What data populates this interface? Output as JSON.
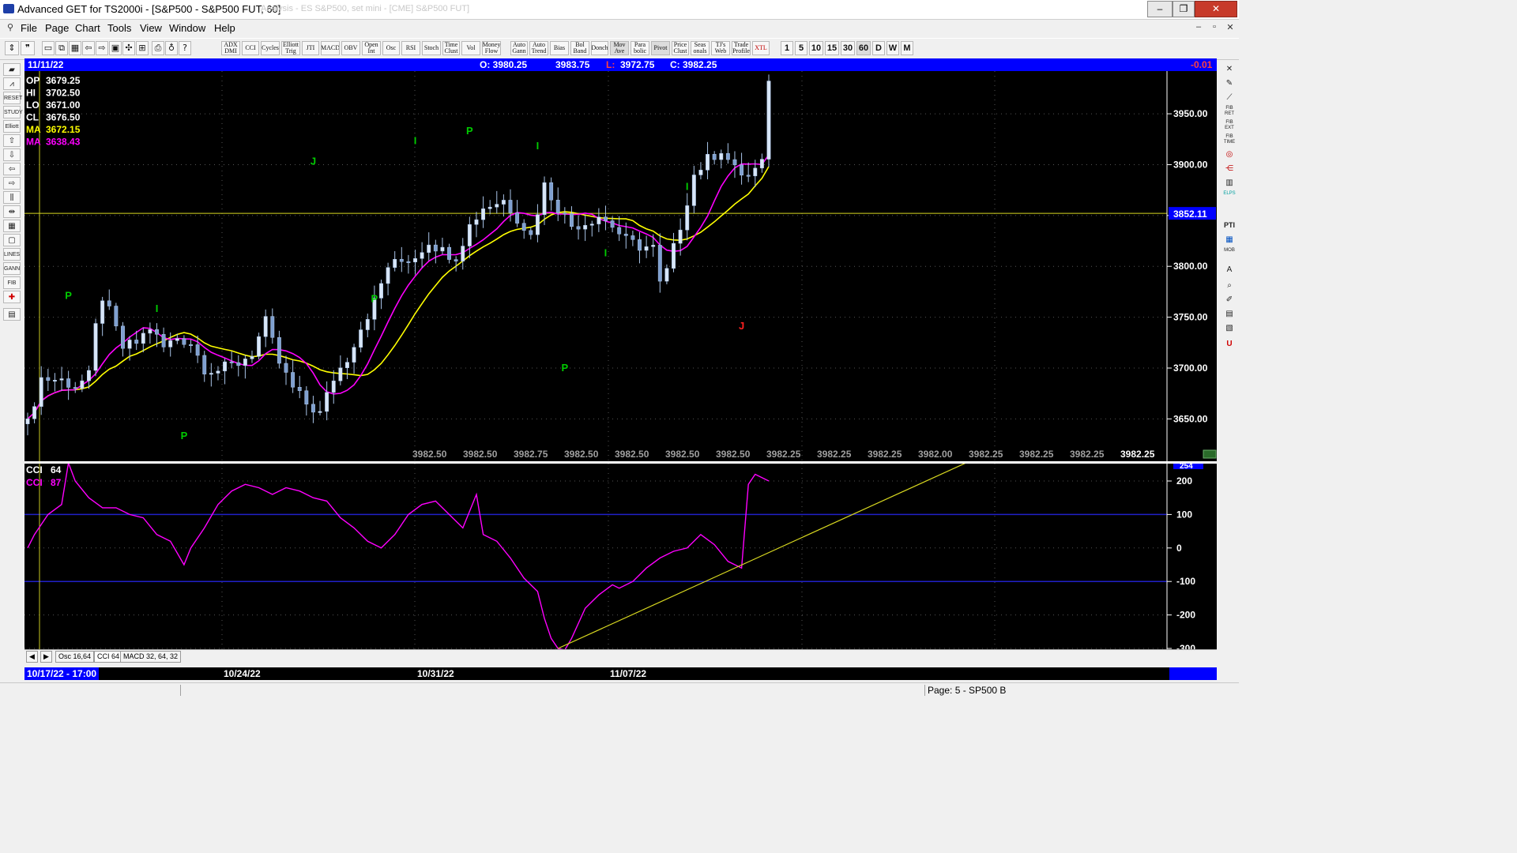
{
  "window": {
    "title": "Advanced GET for TS2000i - [S&P500 - S&P500 FUT, 60]",
    "ghost_text": "Analysis - ES S&P500, set mini - [CME] S&P500 FUT]",
    "controls": {
      "minimize": "–",
      "restore": "❐",
      "close": "✕"
    }
  },
  "menu": {
    "items": [
      "File",
      "Page",
      "Chart",
      "Tools",
      "View",
      "Window",
      "Help"
    ],
    "mdi_controls": {
      "minimize": "–",
      "restore": "▫",
      "close": "✕"
    }
  },
  "toolbar": {
    "studies": [
      "ADX DMI",
      "CCI",
      "Cycles",
      "Elliott Trig",
      "JTI",
      "MACD",
      "OBV",
      "Open Int",
      "Osc",
      "RSI",
      "Stoch",
      "Time Clust",
      "Vol",
      "Money Flow",
      "Auto Gann",
      "Auto Trend",
      "Bias",
      "Bol Band",
      "Donch",
      "Mov Ave",
      "Para bolic",
      "Pivot",
      "Price Clust",
      "Seas onals",
      "TJ's Web",
      "Trade Profile",
      "XTL"
    ],
    "timeframes": [
      "1",
      "5",
      "10",
      "15",
      "30",
      "60",
      "D",
      "W",
      "M"
    ],
    "selected_timeframe": "60"
  },
  "left_tools": [
    "RESET",
    "STUDY",
    "Elliott",
    "LINES",
    "GANN",
    "FIB"
  ],
  "right_tools": [
    "FIB RET",
    "FIB EXT",
    "FIB TIME",
    "ELPS",
    "PTI",
    "MOB"
  ],
  "info_bar": {
    "date": "11/11/22",
    "open": "O: 3980.25",
    "high": "3983.75",
    "low_label": "L:",
    "low_value": "3972.75",
    "close": "C: 3982.25",
    "change": "-0.01",
    "bg_color": "#0000ff"
  },
  "price_legend": [
    {
      "label": "OP",
      "value": "3679.25",
      "color": "#ffffff"
    },
    {
      "label": "HI",
      "value": "3702.50",
      "color": "#ffffff"
    },
    {
      "label": "LO",
      "value": "3671.00",
      "color": "#ffffff"
    },
    {
      "label": "CL",
      "value": "3676.50",
      "color": "#ffffff"
    },
    {
      "label": "MA",
      "value": "3672.15",
      "color": "#ffff00"
    },
    {
      "label": "MA",
      "value": "3638.43",
      "color": "#ff00ff"
    }
  ],
  "cci_legend": [
    {
      "label": "CCI",
      "value": "64",
      "color": "#ffffff"
    },
    {
      "label": "CCI",
      "value": "87",
      "color": "#ff00ff"
    }
  ],
  "bottom_quotes": [
    "3982.50",
    "3982.50",
    "3982.75",
    "3982.50",
    "3982.50",
    "3982.50",
    "3982.50",
    "3982.25",
    "3982.25",
    "3982.25",
    "3982.00",
    "3982.25",
    "3982.25",
    "3982.25",
    "3982.25"
  ],
  "tabs": [
    "Osc 16,64",
    "CCI 64",
    "MACD 32, 64, 32"
  ],
  "active_tab": "CCI 64",
  "dates": [
    "10/17/22 - 17:00",
    "10/24/22",
    "10/31/22",
    "11/07/22"
  ],
  "status": {
    "page": "Page: 5 - SP500 B"
  },
  "chart_data": [
    {
      "type": "candlestick",
      "title": "S&P500 FUT, 60",
      "ylim": [
        3620,
        3985
      ],
      "yticks": [
        3650,
        3700,
        3750,
        3800,
        3850,
        3900,
        3950
      ],
      "ytick_labels": [
        "3650.00",
        "3700.00",
        "3750.00",
        "3800.00",
        "3850.00",
        "3900.00",
        "3950.00"
      ],
      "reference_line": {
        "value": 3852.11,
        "label": "3852.11",
        "color": "#d8d820"
      },
      "x_count": 110,
      "close_path": [
        [
          0,
          3645
        ],
        [
          2,
          3690
        ],
        [
          5,
          3688
        ],
        [
          7,
          3682
        ],
        [
          9,
          3692
        ],
        [
          10,
          3740
        ],
        [
          11,
          3770
        ],
        [
          12,
          3755
        ],
        [
          14,
          3720
        ],
        [
          16,
          3725
        ],
        [
          18,
          3740
        ],
        [
          20,
          3720
        ],
        [
          22,
          3730
        ],
        [
          24,
          3725
        ],
        [
          26,
          3700
        ],
        [
          28,
          3698
        ],
        [
          31,
          3705
        ],
        [
          33,
          3715
        ],
        [
          35,
          3745
        ],
        [
          37,
          3705
        ],
        [
          39,
          3680
        ],
        [
          41,
          3665
        ],
        [
          43,
          3655
        ],
        [
          45,
          3690
        ],
        [
          47,
          3710
        ],
        [
          49,
          3740
        ],
        [
          51,
          3765
        ],
        [
          53,
          3800
        ],
        [
          55,
          3805
        ],
        [
          57,
          3810
        ],
        [
          59,
          3825
        ],
        [
          61,
          3815
        ],
        [
          63,
          3810
        ],
        [
          65,
          3840
        ],
        [
          67,
          3858
        ],
        [
          70,
          3865
        ],
        [
          72,
          3848
        ],
        [
          74,
          3830
        ],
        [
          76,
          3880
        ],
        [
          78,
          3858
        ],
        [
          80,
          3840
        ],
        [
          82,
          3843
        ],
        [
          84,
          3850
        ],
        [
          86,
          3840
        ],
        [
          88,
          3825
        ],
        [
          90,
          3820
        ],
        [
          92,
          3818
        ],
        [
          93,
          3782
        ],
        [
          94,
          3795
        ],
        [
          96,
          3840
        ],
        [
          98,
          3890
        ],
        [
          100,
          3905
        ],
        [
          102,
          3915
        ],
        [
          104,
          3895
        ],
        [
          106,
          3888
        ],
        [
          108,
          3900
        ],
        [
          109,
          3890
        ]
      ],
      "series": [
        {
          "name": "MA",
          "values": [
            3665,
            3712
          ],
          "color": "#ffff00"
        },
        {
          "name": "MA",
          "values": [
            3630,
            3875
          ],
          "color": "#ff00ff"
        }
      ],
      "annotations": [
        {
          "text": "P",
          "x": 6,
          "y": 3768,
          "color": "#00cc00"
        },
        {
          "text": "I",
          "x": 19,
          "y": 3755,
          "color": "#00cc00"
        },
        {
          "text": "P",
          "x": 23,
          "y": 3630,
          "color": "#00cc00"
        },
        {
          "text": "J",
          "x": 42,
          "y": 3900,
          "color": "#00cc00"
        },
        {
          "text": "P",
          "x": 51,
          "y": 3765,
          "color": "#00cc00"
        },
        {
          "text": "I",
          "x": 57,
          "y": 3920,
          "color": "#00cc00"
        },
        {
          "text": "P",
          "x": 65,
          "y": 3930,
          "color": "#00cc00"
        },
        {
          "text": "I",
          "x": 75,
          "y": 3915,
          "color": "#00cc00"
        },
        {
          "text": "P",
          "x": 79,
          "y": 3697,
          "color": "#00cc00"
        },
        {
          "text": "I",
          "x": 85,
          "y": 3810,
          "color": "#00cc00"
        },
        {
          "text": "I",
          "x": 97,
          "y": 3875,
          "color": "#00cc00"
        },
        {
          "text": "J",
          "x": 105,
          "y": 3738,
          "color": "#ff2020"
        }
      ]
    },
    {
      "type": "line",
      "title": "CCI 64",
      "ylim": [
        -305,
        254
      ],
      "yticks": [
        200,
        100,
        0,
        -100,
        -200,
        -300
      ],
      "ytick_labels": [
        "200",
        "100",
        "0",
        "-100",
        "-200",
        "-300"
      ],
      "top_label": "254",
      "band_lines": [
        100,
        -100
      ],
      "series": [
        {
          "name": "CCI",
          "color": "#ff00ff",
          "points": [
            [
              0,
              0
            ],
            [
              1,
              40
            ],
            [
              3,
              100
            ],
            [
              5,
              130
            ],
            [
              6,
              254
            ],
            [
              7,
              200
            ],
            [
              9,
              150
            ],
            [
              11,
              120
            ],
            [
              13,
              120
            ],
            [
              15,
              100
            ],
            [
              17,
              90
            ],
            [
              19,
              40
            ],
            [
              21,
              20
            ],
            [
              23,
              -50
            ],
            [
              24,
              0
            ],
            [
              26,
              60
            ],
            [
              28,
              130
            ],
            [
              30,
              170
            ],
            [
              32,
              190
            ],
            [
              34,
              180
            ],
            [
              36,
              160
            ],
            [
              38,
              180
            ],
            [
              40,
              170
            ],
            [
              42,
              150
            ],
            [
              44,
              140
            ],
            [
              46,
              90
            ],
            [
              48,
              60
            ],
            [
              50,
              20
            ],
            [
              52,
              0
            ],
            [
              54,
              40
            ],
            [
              56,
              100
            ],
            [
              58,
              130
            ],
            [
              60,
              140
            ],
            [
              62,
              100
            ],
            [
              64,
              60
            ],
            [
              66,
              160
            ],
            [
              67,
              40
            ],
            [
              69,
              20
            ],
            [
              71,
              -30
            ],
            [
              73,
              -90
            ],
            [
              75,
              -130
            ],
            [
              76,
              -210
            ],
            [
              77,
              -270
            ],
            [
              78,
              -300
            ],
            [
              79,
              -305
            ],
            [
              80,
              -270
            ],
            [
              82,
              -180
            ],
            [
              84,
              -140
            ],
            [
              86,
              -110
            ],
            [
              87,
              -120
            ],
            [
              89,
              -100
            ],
            [
              91,
              -60
            ],
            [
              93,
              -30
            ],
            [
              95,
              -10
            ],
            [
              97,
              0
            ],
            [
              99,
              40
            ],
            [
              101,
              10
            ],
            [
              103,
              -40
            ],
            [
              105,
              -60
            ],
            [
              106,
              190
            ],
            [
              107,
              220
            ],
            [
              108,
              210
            ],
            [
              109,
              200
            ]
          ]
        },
        {
          "name": "trendline",
          "color": "#d8d820",
          "points": [
            [
              78,
              -300
            ],
            [
              138,
              254
            ]
          ]
        }
      ]
    }
  ]
}
